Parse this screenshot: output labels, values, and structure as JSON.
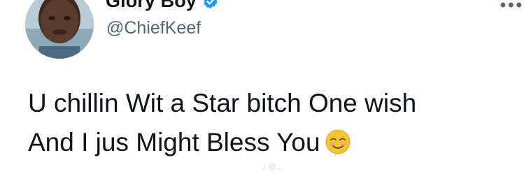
{
  "profile": {
    "display_name": "Glory Boy",
    "handle": "@ChiefKeef",
    "verified_icon": "verified-badge-icon",
    "more_icon": "more-options-icon",
    "more_glyph": "•••"
  },
  "tweet": {
    "line1": "U chillin Wit a Star bitch One wish",
    "line2": "And I jus Might Bless You",
    "emoji": "smiling-face-with-blush-icon"
  },
  "watermark": {
    "text": "♪ @..."
  },
  "colors": {
    "text": "#0f1419",
    "secondary": "#536471",
    "verified": "#1d9bf0"
  }
}
